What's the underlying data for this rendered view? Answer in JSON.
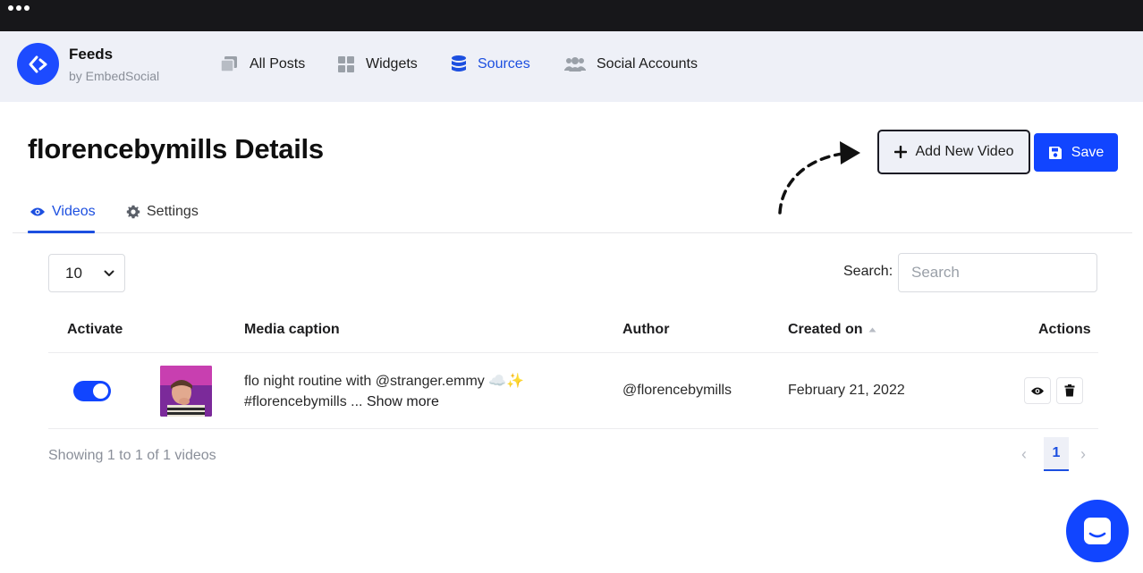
{
  "brand": {
    "name": "Feeds",
    "subtitle": "by EmbedSocial"
  },
  "nav": {
    "items": [
      {
        "label": "All Posts",
        "icon": "posts-stack-icon"
      },
      {
        "label": "Widgets",
        "icon": "widgets-grid-icon"
      },
      {
        "label": "Sources",
        "icon": "database-icon",
        "active": true
      },
      {
        "label": "Social Accounts",
        "icon": "users-icon"
      }
    ]
  },
  "page": {
    "title": "florencebymills Details"
  },
  "actions": {
    "add_label": "Add New Video",
    "save_label": "Save"
  },
  "tabs": [
    {
      "label": "Videos",
      "icon": "eye-icon",
      "active": true
    },
    {
      "label": "Settings",
      "icon": "gear-icon"
    }
  ],
  "table_controls": {
    "page_length": "10",
    "search_label": "Search:",
    "search_placeholder": "Search"
  },
  "table": {
    "columns": [
      "Activate",
      "Media caption",
      "Author",
      "Created on",
      "Actions"
    ],
    "sorted_column": "Created on",
    "rows": [
      {
        "active": true,
        "caption": "flo night routine with @stranger.emmy ☁️✨ #florencebymills ...",
        "show_more": "Show more",
        "author": "@florencebymills",
        "created_on": "February 21, 2022"
      }
    ]
  },
  "footer": {
    "showing": "Showing 1 to 1 of 1 videos",
    "current_page": "1"
  },
  "colors": {
    "accent": "#1145ff",
    "nav_bg": "#eef0f7",
    "window_bar": "#17171a"
  }
}
